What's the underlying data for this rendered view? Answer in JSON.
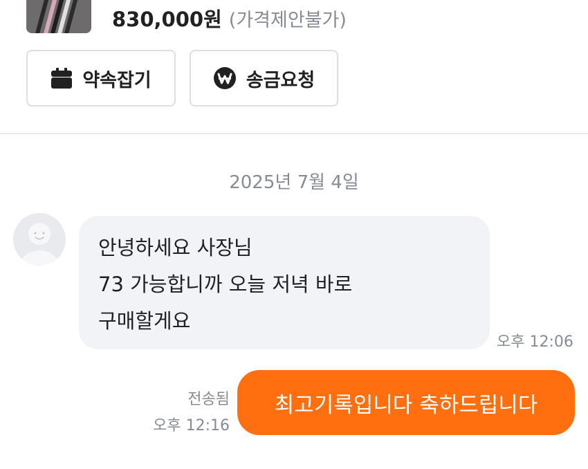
{
  "product": {
    "price": "830,000원",
    "price_note": "(가격제안불가)",
    "thumbnail_icon": "product-photo"
  },
  "actions": {
    "appointment": {
      "label": "약속잡기",
      "icon": "calendar-icon"
    },
    "remit": {
      "label": "송금요청",
      "icon": "won-coin-icon"
    }
  },
  "chat": {
    "date_header": "2025년 7월 4일",
    "messages": [
      {
        "direction": "incoming",
        "lines": [
          "안녕하세요 사장님",
          "73 가능합니까 오늘 저녁 바로",
          "구매할게요"
        ],
        "time": "오후 12:06"
      },
      {
        "direction": "outgoing",
        "text": "최고기록입니다 축하드립니다",
        "status": "전송됨",
        "time": "오후 12:16"
      }
    ]
  },
  "colors": {
    "accent": "#ff6f0f",
    "incoming_bubble": "#f2f3f6",
    "text_primary": "#212124",
    "text_secondary": "#868b94",
    "button_border": "#dcdee3"
  }
}
